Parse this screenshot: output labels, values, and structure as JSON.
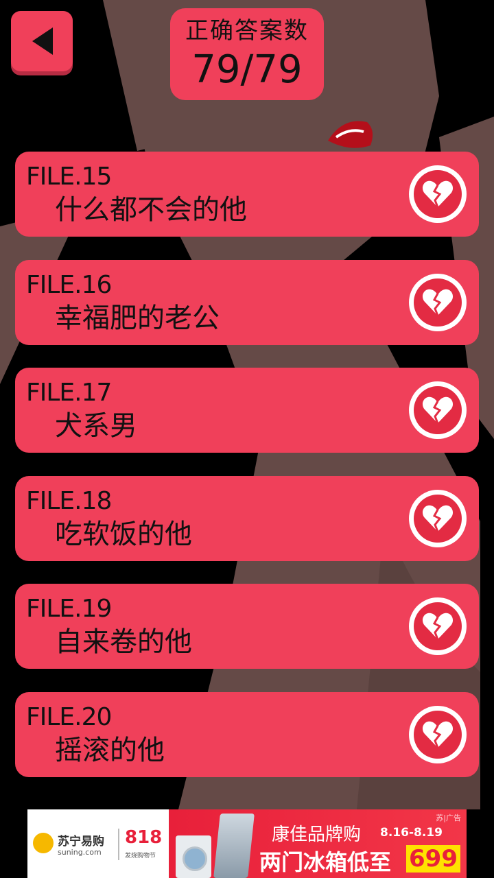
{
  "header": {
    "score_title": "正确答案数",
    "score_value": "79/79"
  },
  "back_icon": "back-triangle-icon",
  "files": [
    {
      "file": "FILE.15",
      "title": "什么都不会的他",
      "icon": "broken-heart-icon"
    },
    {
      "file": "FILE.16",
      "title": "幸福肥的老公",
      "icon": "broken-heart-icon"
    },
    {
      "file": "FILE.17",
      "title": "犬系男",
      "icon": "broken-heart-icon"
    },
    {
      "file": "FILE.18",
      "title": "吃软饭的他",
      "icon": "broken-heart-icon"
    },
    {
      "file": "FILE.19",
      "title": "自来卷的他",
      "icon": "broken-heart-icon"
    },
    {
      "file": "FILE.20",
      "title": "摇滚的他",
      "icon": "broken-heart-icon"
    }
  ],
  "ad": {
    "brand": "苏宁易购",
    "brand_sub": "suning.com",
    "promo_num": "818",
    "promo_sub": "发烧购物节",
    "tag": "苏|广告",
    "line1": "康佳品牌购",
    "dates": "8.16-8.19",
    "line2": "两门冰箱低至",
    "price": "699"
  },
  "colors": {
    "accent": "#f0405a",
    "heart": "#e32b43",
    "skin": "#654a47"
  }
}
